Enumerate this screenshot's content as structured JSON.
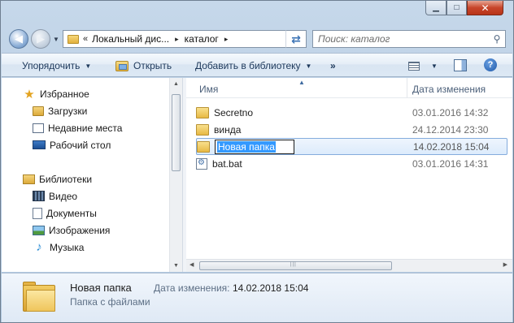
{
  "window": {
    "controls": {
      "minimize": "▁",
      "maximize": "□",
      "close": "✕"
    }
  },
  "address": {
    "chevron": "«",
    "crumbs": [
      "Локальный дис...",
      "каталог"
    ],
    "separator": "▸"
  },
  "search": {
    "placeholder": "Поиск: каталог"
  },
  "toolbar": {
    "organize": "Упорядочить",
    "open": "Открыть",
    "add_to_library": "Добавить в библиотеку",
    "more": "»"
  },
  "sidebar": {
    "favorites": {
      "label": "Избранное",
      "icon": "star-icon"
    },
    "favorites_items": [
      {
        "label": "Загрузки",
        "icon": "downloads-icon"
      },
      {
        "label": "Недавние места",
        "icon": "recent-places-icon"
      },
      {
        "label": "Рабочий стол",
        "icon": "desktop-icon"
      }
    ],
    "libraries": {
      "label": "Библиотеки",
      "icon": "libraries-icon"
    },
    "libraries_items": [
      {
        "label": "Видео",
        "icon": "video-icon"
      },
      {
        "label": "Документы",
        "icon": "documents-icon"
      },
      {
        "label": "Изображения",
        "icon": "pictures-icon"
      },
      {
        "label": "Музыка",
        "icon": "music-icon"
      }
    ]
  },
  "columns": {
    "name": "Имя",
    "date": "Дата изменения"
  },
  "files": [
    {
      "name": "Secretno",
      "date": "03.01.2016 14:32",
      "type": "folder"
    },
    {
      "name": "винда",
      "date": "24.12.2014 23:30",
      "type": "folder"
    },
    {
      "name": "Новая папка",
      "date": "14.02.2018 15:04",
      "type": "folder",
      "selected": true,
      "renaming": true
    },
    {
      "name": "bat.bat",
      "date": "03.01.2016 14:31",
      "type": "bat"
    }
  ],
  "details": {
    "name": "Новая папка",
    "type": "Папка с файлами",
    "date_label": "Дата изменения:",
    "date_value": "14.02.2018 15:04"
  }
}
